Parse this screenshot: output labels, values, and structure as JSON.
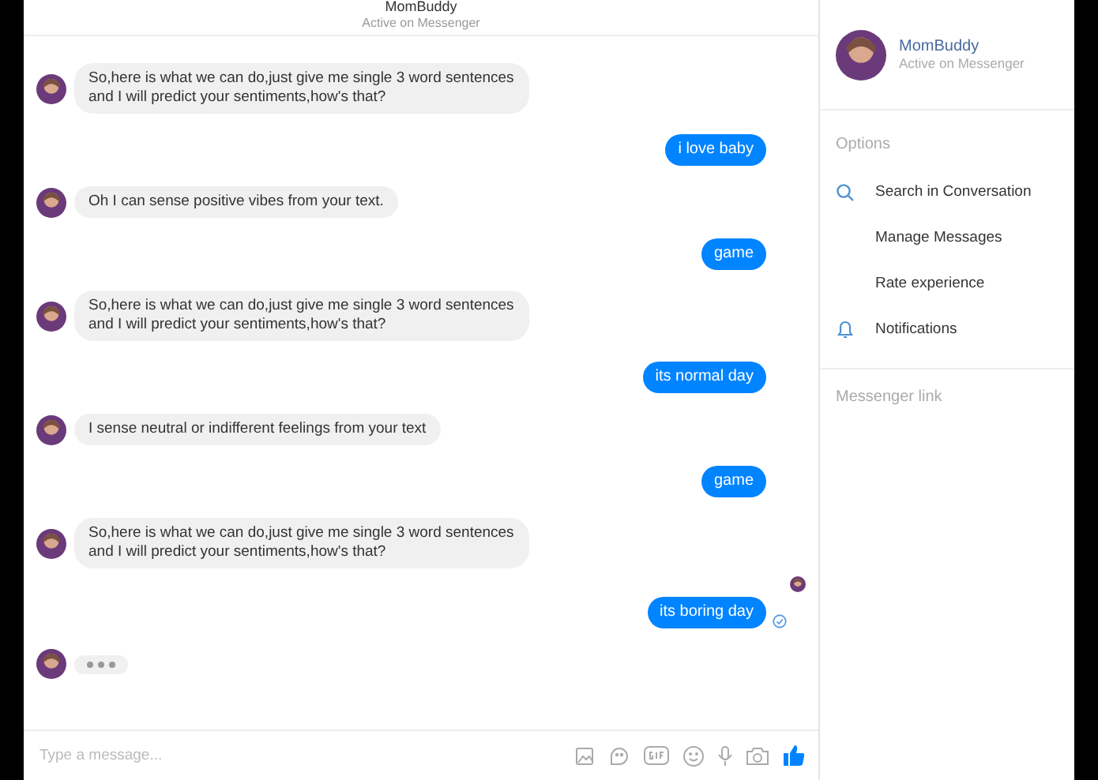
{
  "header": {
    "title": "MomBuddy",
    "subtitle": "Active on Messenger"
  },
  "messages": [
    {
      "kind": "incoming",
      "text": "So,here is what we can do,just give me single 3 word sentences and I will predict your sentiments,how's that?"
    },
    {
      "kind": "outgoing",
      "text": "i love baby",
      "delivered": false
    },
    {
      "kind": "incoming",
      "text": "Oh I can sense positive vibes from your text."
    },
    {
      "kind": "outgoing",
      "text": "game",
      "delivered": false
    },
    {
      "kind": "incoming",
      "text": "So,here is what we can do,just give me single 3 word sentences and I will predict your sentiments,how's that?"
    },
    {
      "kind": "outgoing",
      "text": "its normal day",
      "delivered": false
    },
    {
      "kind": "incoming",
      "text": "I sense neutral or indifferent feelings from your text"
    },
    {
      "kind": "outgoing",
      "text": "game",
      "delivered": false
    },
    {
      "kind": "incoming",
      "text": "So,here is what we can do,just give me single 3 word sentences and I will predict your sentiments,how's that?"
    },
    {
      "kind": "seen"
    },
    {
      "kind": "outgoing",
      "text": "its boring day",
      "delivered": true
    },
    {
      "kind": "typing"
    }
  ],
  "composer": {
    "placeholder": "Type a message..."
  },
  "sidebar": {
    "name": "MomBuddy",
    "status": "Active on Messenger",
    "options_label": "Options",
    "options": [
      {
        "label": "Search in Conversation",
        "kind": "search"
      },
      {
        "label": "Manage Messages",
        "kind": "plain"
      },
      {
        "label": "Rate experience",
        "kind": "plain"
      },
      {
        "label": "Notifications",
        "kind": "notify"
      }
    ],
    "link_label": "Messenger link"
  }
}
